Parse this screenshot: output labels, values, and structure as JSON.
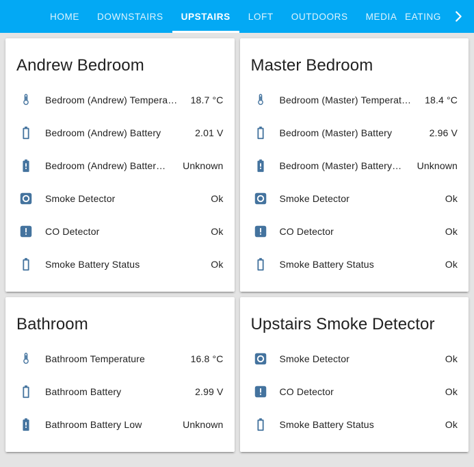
{
  "navbar": {
    "background_color": "#03A9F4",
    "tabs": [
      {
        "label": "HOME",
        "active": false
      },
      {
        "label": "DOWNSTAIRS",
        "active": false
      },
      {
        "label": "UPSTAIRS",
        "active": true
      },
      {
        "label": "LOFT",
        "active": false
      },
      {
        "label": "OUTDOORS",
        "active": false
      },
      {
        "label": "MEDIA",
        "active": false
      },
      {
        "label": "HEATING &",
        "active": false
      }
    ],
    "overflow_arrow_icon": "chevron-right-icon"
  },
  "theme": {
    "page_background": "#e4e4e4",
    "card_background": "#ffffff",
    "icon_color": "#44739e",
    "text_color": "#212121",
    "accent": "#03A9F4"
  },
  "cards": [
    {
      "title": "Andrew Bedroom",
      "rows": [
        {
          "icon": "thermometer-icon",
          "label": "Bedroom (Andrew) Tempera…",
          "value": "18.7 °C"
        },
        {
          "icon": "battery-icon",
          "label": "Bedroom (Andrew) Battery",
          "value": "2.01 V"
        },
        {
          "icon": "battery-alert-icon",
          "label": "Bedroom (Andrew) Batter…",
          "value": "Unknown"
        },
        {
          "icon": "smoke-detector-icon",
          "label": "Smoke Detector",
          "value": "Ok"
        },
        {
          "icon": "co-detector-icon",
          "label": "CO Detector",
          "value": "Ok"
        },
        {
          "icon": "battery-icon",
          "label": "Smoke Battery Status",
          "value": "Ok"
        }
      ]
    },
    {
      "title": "Master Bedroom",
      "rows": [
        {
          "icon": "thermometer-icon",
          "label": "Bedroom (Master) Temperat…",
          "value": "18.4 °C"
        },
        {
          "icon": "battery-icon",
          "label": "Bedroom (Master) Battery",
          "value": "2.96 V"
        },
        {
          "icon": "battery-alert-icon",
          "label": "Bedroom (Master) Battery…",
          "value": "Unknown"
        },
        {
          "icon": "smoke-detector-icon",
          "label": "Smoke Detector",
          "value": "Ok"
        },
        {
          "icon": "co-detector-icon",
          "label": "CO Detector",
          "value": "Ok"
        },
        {
          "icon": "battery-icon",
          "label": "Smoke Battery Status",
          "value": "Ok"
        }
      ]
    },
    {
      "title": "Bathroom",
      "rows": [
        {
          "icon": "thermometer-icon",
          "label": "Bathroom Temperature",
          "value": "16.8 °C"
        },
        {
          "icon": "battery-icon",
          "label": "Bathroom Battery",
          "value": "2.99 V"
        },
        {
          "icon": "battery-alert-icon",
          "label": "Bathroom Battery Low",
          "value": "Unknown"
        }
      ]
    },
    {
      "title": "Upstairs Smoke Detector",
      "rows": [
        {
          "icon": "smoke-detector-icon",
          "label": "Smoke Detector",
          "value": "Ok"
        },
        {
          "icon": "co-detector-icon",
          "label": "CO Detector",
          "value": "Ok"
        },
        {
          "icon": "battery-icon",
          "label": "Smoke Battery Status",
          "value": "Ok"
        }
      ]
    }
  ]
}
